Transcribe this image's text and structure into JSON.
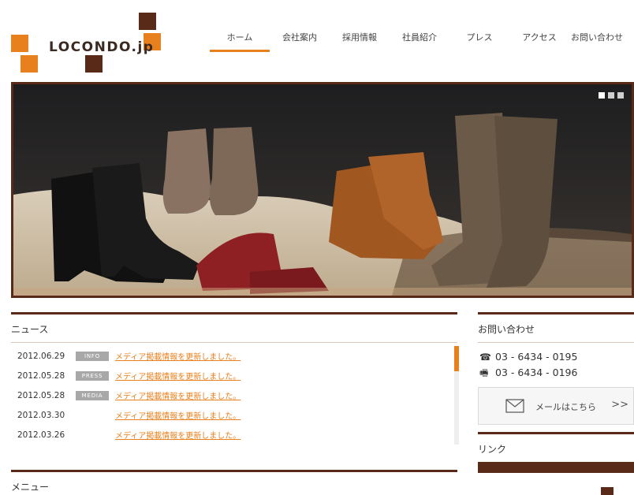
{
  "logo": {
    "text": "LOCONDO.jp",
    "colors": {
      "orange": "#e8801e",
      "brown": "#5a2a18"
    }
  },
  "nav": {
    "items": [
      "ホーム",
      "会社案内",
      "採用情報",
      "社員紹介",
      "プレス",
      "アクセス",
      "お問い合わせ"
    ],
    "active_index": 0
  },
  "hero": {
    "slide_count": 3,
    "active_slide": 1
  },
  "news": {
    "title": "ニュース",
    "items": [
      {
        "date": "2012.06.29",
        "badge": "INFO",
        "text": "メディア掲載情報を更新しました。"
      },
      {
        "date": "2012.05.28",
        "badge": "PRESS",
        "text": "メディア掲載情報を更新しました。"
      },
      {
        "date": "2012.05.28",
        "badge": "MEDIA",
        "text": "メディア掲載情報を更新しました。"
      },
      {
        "date": "2012.03.30",
        "badge": "",
        "text": "メディア掲載情報を更新しました。"
      },
      {
        "date": "2012.03.26",
        "badge": "",
        "text": "メディア掲載情報を更新しました。"
      }
    ]
  },
  "menu": {
    "title": "メニュー"
  },
  "contact": {
    "title": "お問い合わせ",
    "phone": "03 - 6434 - 0195",
    "fax": "03 - 6434 - 0196",
    "phone_icon": "phone-icon",
    "fax_icon": "fax-icon",
    "mail_label": "メールはこちら",
    "mail_arrow": ">>"
  },
  "links": {
    "title": "リンク"
  }
}
